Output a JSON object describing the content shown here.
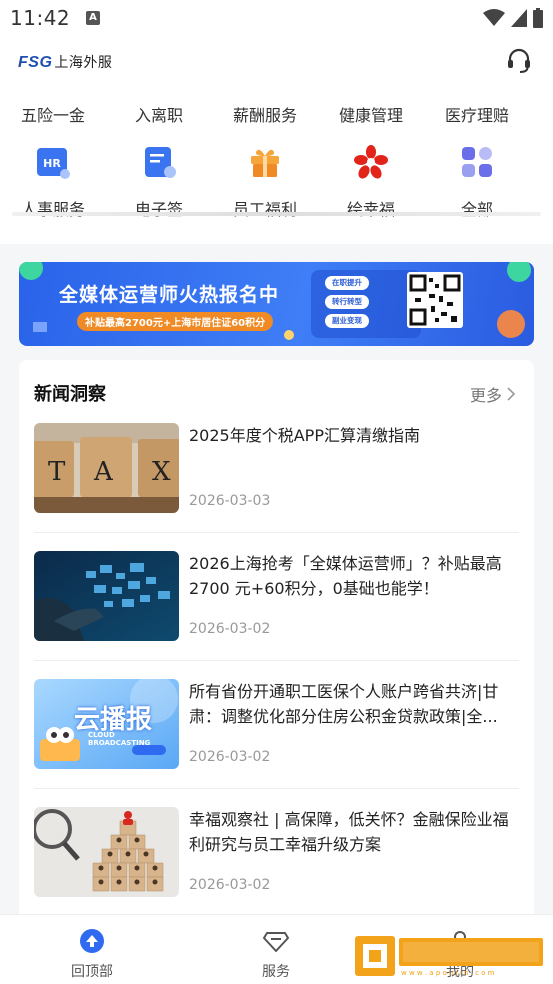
{
  "status": {
    "time": "11:42"
  },
  "header": {
    "logo_latin": "FSG",
    "logo_cn": "上海外服"
  },
  "quick_tabs": [
    "五险一金",
    "入离职",
    "薪酬服务",
    "健康管理",
    "医疗理赔"
  ],
  "services": [
    {
      "label": "人事服务",
      "icon": "hr-icon"
    },
    {
      "label": "电子签",
      "icon": "e-sign-icon"
    },
    {
      "label": "员工福利",
      "icon": "gift-icon"
    },
    {
      "label": "绘幸福",
      "icon": "flower-logo-icon"
    },
    {
      "label": "全部",
      "icon": "grid-icon"
    }
  ],
  "banner": {
    "title": "全媒体运营师火热报名中",
    "subtitle": "补贴最高2700元+上海市居住证60积分",
    "pills": [
      "在职提升",
      "转行转型",
      "副业变现"
    ]
  },
  "news": {
    "heading": "新闻洞察",
    "more": "更多",
    "items": [
      {
        "title": "2025年度个税APP汇算清缴指南",
        "date": "2026-03-03"
      },
      {
        "title": "2026上海抢考「全媒体运营师」？补贴最高2700 元+60积分，0基础也能学！",
        "date": "2026-03-02"
      },
      {
        "title": "所有省份开通职工医保个人账户跨省共济|甘肃：调整优化部分住房公积金贷款政策|全...",
        "date": "2026-03-02"
      },
      {
        "title": "幸福观察社 | 高保障，低关怀？金融保险业福利研究与员工幸福升级方案",
        "date": "2026-03-02"
      }
    ]
  },
  "thumbs": {
    "tax_text": "TAX",
    "cloud_title": "云播报",
    "cloud_sub": "CLOUD BROADCASTING"
  },
  "bottom_nav": {
    "home": "回顶部",
    "service": "服务",
    "me": "我的"
  },
  "colors": {
    "accent": "#2f6bf0",
    "orange": "#f08a24",
    "red": "#e2231a"
  }
}
